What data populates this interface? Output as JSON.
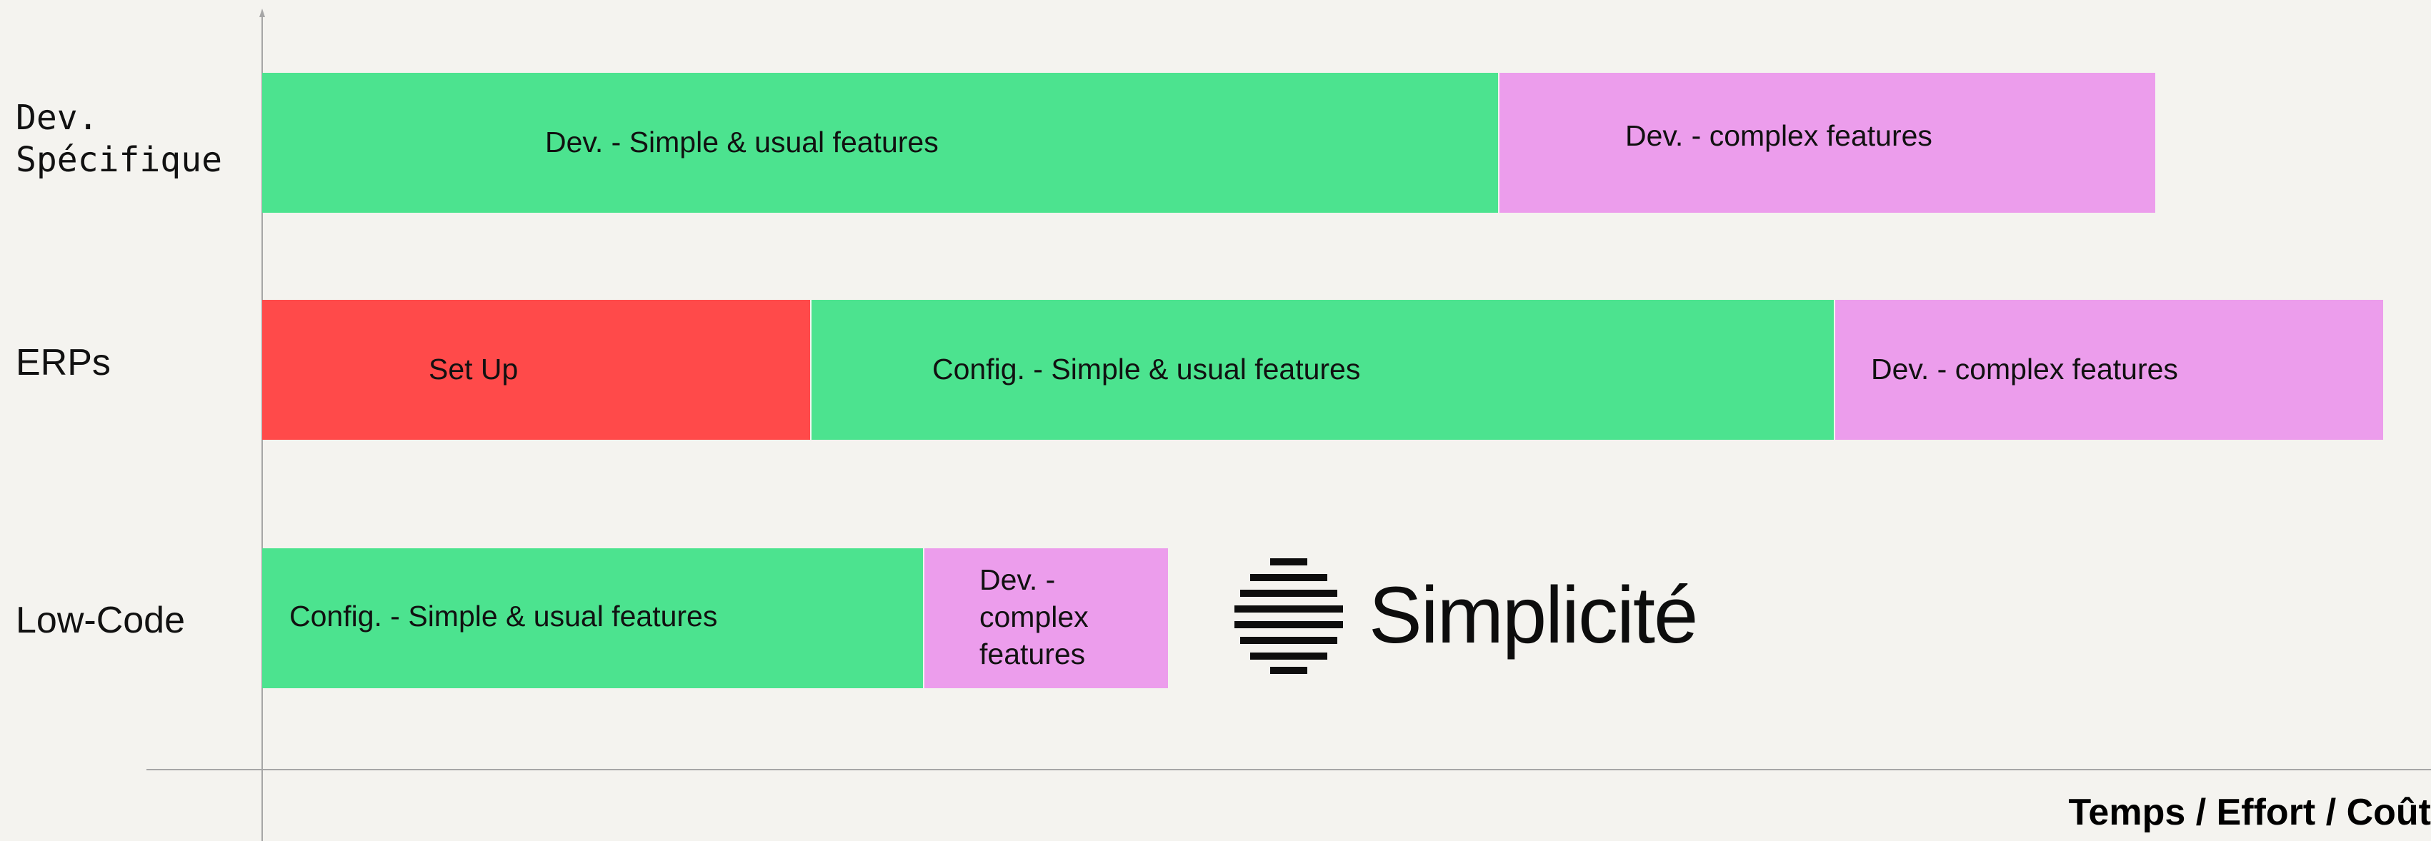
{
  "chart_data": {
    "type": "bar",
    "orientation": "horizontal-stacked",
    "xlabel": "Temps / Effort / Coût",
    "categories": [
      "Dev.\nSpécifique",
      "ERPs",
      "Low-Code"
    ],
    "rows": [
      {
        "label": "Dev.\nSpécifique",
        "segments": [
          {
            "label": "Dev. - Simple & usual features",
            "value": 1731,
            "color": "#4ce38f"
          },
          {
            "label": "Dev. - complex features",
            "value": 919,
            "color": "#ec9dec"
          }
        ]
      },
      {
        "label": "ERPs",
        "segments": [
          {
            "label": "Set Up",
            "value": 768,
            "color": "#ff4a4a"
          },
          {
            "label": "Config. - Simple & usual features",
            "value": 1433,
            "color": "#4ce38f"
          },
          {
            "label": "Dev. - complex features",
            "value": 768,
            "color": "#ec9dec"
          }
        ]
      },
      {
        "label": "Low-Code",
        "segments": [
          {
            "label": "Config. - Simple & usual features",
            "value": 926,
            "color": "#4ce38f"
          },
          {
            "label": "Dev. -\ncomplex\nfeatures",
            "value": 342,
            "color": "#ec9dec"
          }
        ]
      }
    ],
    "grid": false,
    "legend": "none"
  },
  "logo": {
    "text": "Simplicité",
    "icon": "striped-circle-icon"
  }
}
